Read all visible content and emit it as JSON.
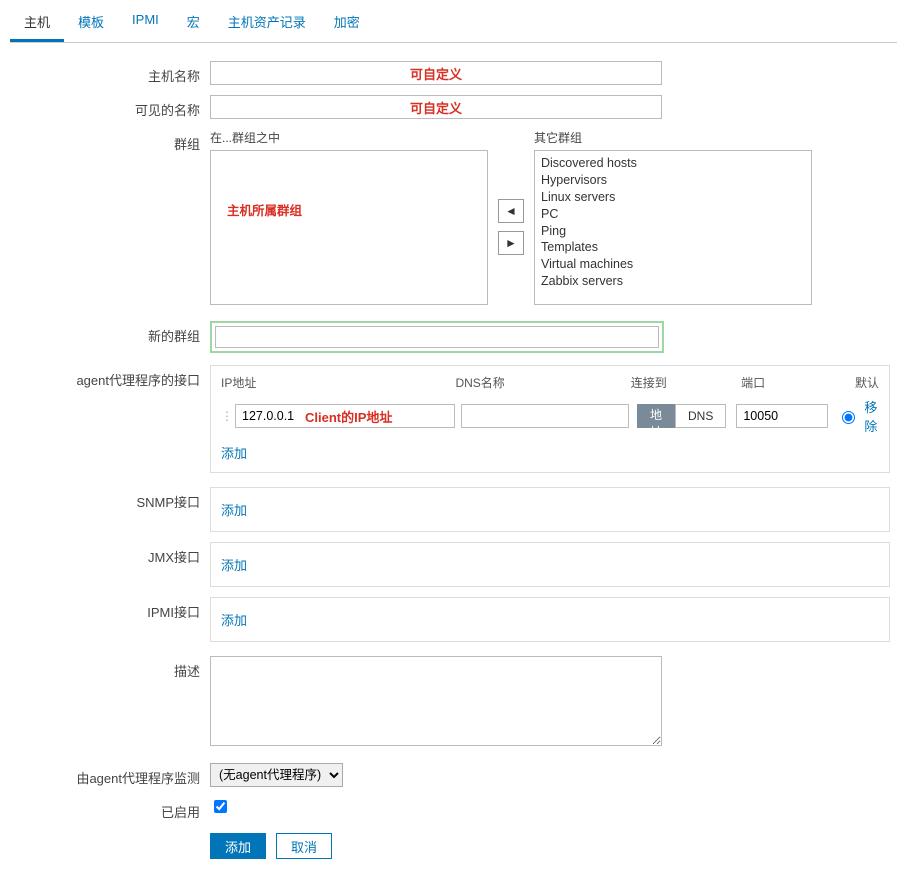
{
  "tabs": {
    "items": [
      {
        "label": "主机",
        "active": true
      },
      {
        "label": "模板",
        "active": false
      },
      {
        "label": "IPMI",
        "active": false
      },
      {
        "label": "宏",
        "active": false
      },
      {
        "label": "主机资产记录",
        "active": false
      },
      {
        "label": "加密",
        "active": false
      }
    ]
  },
  "form": {
    "hostname_label": "主机名称",
    "hostname_value": "可自定义",
    "visiblename_label": "可见的名称",
    "visiblename_value": "可自定义",
    "groups_label": "群组",
    "in_groups_label": "在...群组之中",
    "in_groups_placeholder": "主机所属群组",
    "other_groups_label": "其它群组",
    "other_groups": [
      "Discovered hosts",
      "Hypervisors",
      "Linux servers",
      "PC",
      "Ping",
      "Templates",
      "Virtual machines",
      "Zabbix servers"
    ],
    "newgroup_label": "新的群组",
    "newgroup_value": ""
  },
  "agent": {
    "label": "agent代理程序的接口",
    "header_ip": "IP地址",
    "header_dns": "DNS名称",
    "header_conn": "连接到",
    "header_port": "端口",
    "header_default": "默认",
    "ip_value": "127.0.0.1",
    "ip_annotation": "Client的IP地址",
    "dns_value": "",
    "conn_ip_label": "IP地址",
    "conn_dns_label": "DNS",
    "port_value": "10050",
    "remove_label": "移除",
    "add_label": "添加"
  },
  "snmp": {
    "label": "SNMP接口",
    "add_label": "添加"
  },
  "jmx": {
    "label": "JMX接口",
    "add_label": "添加"
  },
  "ipmi": {
    "label": "IPMI接口",
    "add_label": "添加"
  },
  "description": {
    "label": "描述",
    "value": ""
  },
  "proxy": {
    "label": "由agent代理程序监测",
    "selected": "(无agent代理程序)"
  },
  "enabled": {
    "label": "已启用",
    "checked": true
  },
  "actions": {
    "submit": "添加",
    "cancel": "取消"
  },
  "icons": {
    "left_arrow": "◄",
    "right_arrow": "►",
    "drag": "⋮⋮"
  }
}
